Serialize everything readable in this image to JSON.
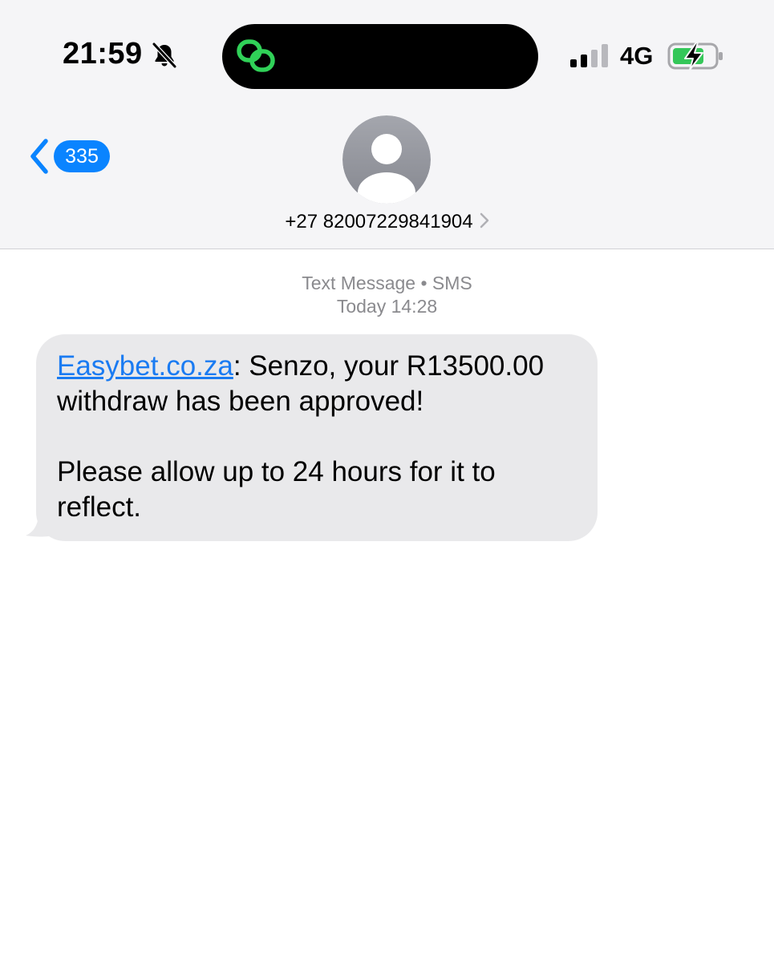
{
  "status_bar": {
    "time": "21:59",
    "network": "4G",
    "icons": [
      "bell-slash-icon",
      "link-icon",
      "signal-bars-icon",
      "battery-charging-icon"
    ],
    "colors": {
      "island_accent": "#30d158",
      "battery_fill": "#34c759"
    }
  },
  "nav": {
    "back_count": "335",
    "contact": "+27 82007229841904"
  },
  "conversation": {
    "service": "Text Message • SMS",
    "timestamp": "Today 14:28",
    "message": {
      "link_text": "Easybet.co.za",
      "line1_rest": ": Senzo, your R13500.00 withdraw has been approved!",
      "line2": "Please allow up to 24 hours for it to reflect."
    }
  },
  "colors": {
    "accent": "#0a84ff",
    "link": "#1a7bf2",
    "bubble": "#e9e9eb",
    "header_bg": "#f5f5f7",
    "meta_text": "#8a8a8e"
  }
}
